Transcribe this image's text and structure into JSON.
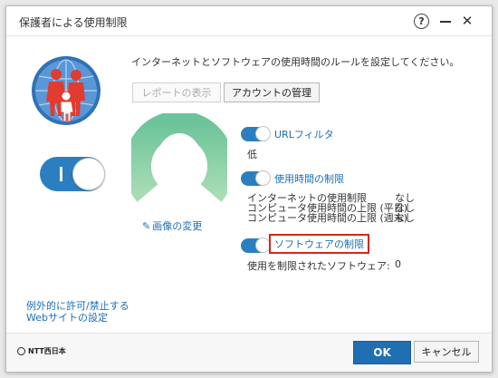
{
  "window": {
    "title": "保護者による使用制限",
    "help_label": "?",
    "close_label": "✕"
  },
  "intro": "インターネットとソフトウェアの使用時間のルールを設定してください。",
  "buttons": {
    "report": "レポートの表示",
    "account": "アカウントの管理",
    "ok": "OK",
    "cancel": "キャンセル"
  },
  "main_toggle": {
    "state": "on",
    "label": "I"
  },
  "change_image": "画像の変更",
  "settings": {
    "url_filter": {
      "label": "URLフィルタ",
      "enabled": true,
      "detail": "低"
    },
    "time_limit": {
      "label": "使用時間の制限",
      "enabled": true,
      "rows": [
        {
          "label": "インターネットの使用制限",
          "value": "なし"
        },
        {
          "label": "コンピュータ使用時間の上限 (平日)",
          "value": "なし"
        },
        {
          "label": "コンピュータ使用時間の上限 (週末)",
          "value": "なし"
        }
      ]
    },
    "software_limit": {
      "label": "ソフトウェアの制限",
      "enabled": true,
      "detail_label": "使用を制限されたソフトウェア:",
      "detail_value": "0"
    }
  },
  "exception_link": [
    "例外的に許可/禁止する",
    "Webサイトの設定"
  ],
  "brand": "NTT西日本",
  "colors": {
    "accent": "#2b7fc0",
    "link": "#1b6fb5",
    "highlight": "#d9251d",
    "ok_button": "#1f6fb2",
    "avatar_ring": "#7ccf95"
  }
}
